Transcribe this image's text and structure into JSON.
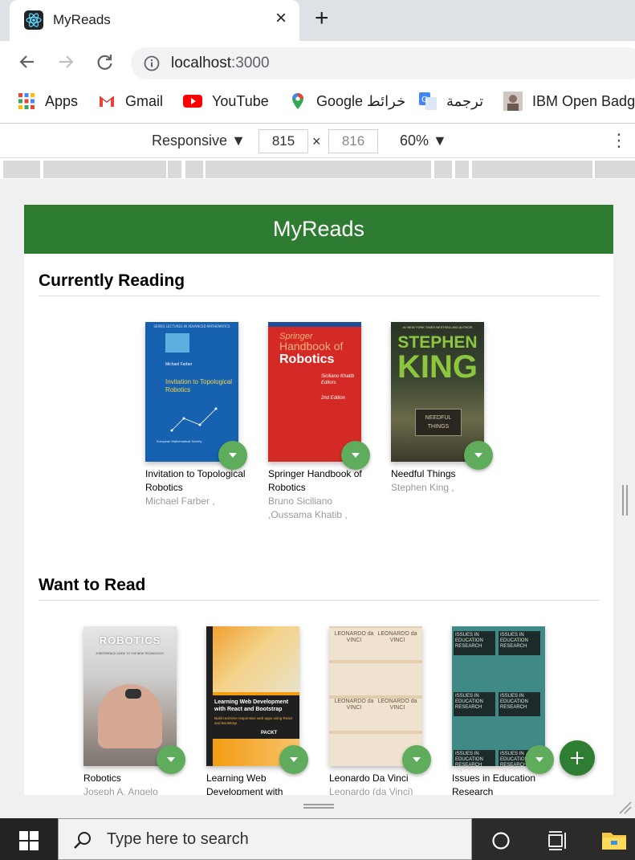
{
  "browser": {
    "tab_title": "MyReads",
    "new_tab": "+",
    "close": "×",
    "url_host": "localhost",
    "url_port": ":3000"
  },
  "bookmarks": [
    {
      "label": "Apps",
      "icon": "apps-grid-icon"
    },
    {
      "label": "Gmail",
      "icon": "gmail-icon"
    },
    {
      "label": "YouTube",
      "icon": "youtube-icon"
    },
    {
      "label": "Google خرائط",
      "icon": "maps-pin-icon"
    },
    {
      "label": "ترجمة",
      "icon": "translate-icon"
    },
    {
      "label": "IBM Open Badge",
      "icon": "profile-photo-icon"
    }
  ],
  "devtools": {
    "mode": "Responsive",
    "width": "815",
    "x": "×",
    "height": "816",
    "zoom": "60%"
  },
  "app": {
    "title": "MyReads",
    "shelves": [
      {
        "title": "Currently Reading",
        "books": [
          {
            "title": "Invitation to Topological Robotics",
            "authors": "Michael Farber ,"
          },
          {
            "title": "Springer Handbook of Robotics",
            "authors": "Bruno Siciliano ,Oussama Khatib ,"
          },
          {
            "title": "Needful Things",
            "authors": "Stephen King ,"
          }
        ]
      },
      {
        "title": "Want to Read",
        "books": [
          {
            "title": "Robotics",
            "authors": "Joseph A. Angelo"
          },
          {
            "title": "Learning Web Development with React and Bootstrap",
            "authors": ""
          },
          {
            "title": "Leonardo Da Vinci",
            "authors": "Leonardo (da Vinci)"
          },
          {
            "title": "Issues in Education Research",
            "authors": ""
          }
        ]
      }
    ]
  },
  "covers": {
    "topology_header": "SERIES LECTURES IN ADVANCED MATHEMATICS",
    "topology_author": "Michael Farber",
    "topology_title": "Invitation to Topological Robotics",
    "topology_publisher": "European Mathematical Society",
    "springer_brand": "Springer",
    "springer_handbook": "Handbook of",
    "springer_robotics": "Robotics",
    "springer_editors": "Siciliano Khatib Editors",
    "springer_edition": "2nd Edition",
    "king_tagline": "#1 NEW YORK TIMES BESTSELLING AUTHOR",
    "king_first": "STEPHEN",
    "king_last": "KING",
    "king_sign": "NEEDFUL THINGS",
    "robotics_word": "ROBOTICS",
    "robotics_sub": "A REFERENCE GUIDE TO THE NEW TECHNOLOGY",
    "react_title": "Learning Web Development with React and Bootstrap",
    "react_sub": "Build real-time responsive web apps using React and Bootstrap",
    "react_publisher": "PACKT",
    "davinci_word": "LEONARDO da VINCI",
    "issues_word": "ISSUES IN EDUCATION RESEARCH"
  },
  "taskbar": {
    "search_placeholder": "Type here to search"
  },
  "colors": {
    "header_green": "#2e7c31",
    "changer_green": "#60ac5d",
    "add_button_green": "#2e7d32"
  }
}
